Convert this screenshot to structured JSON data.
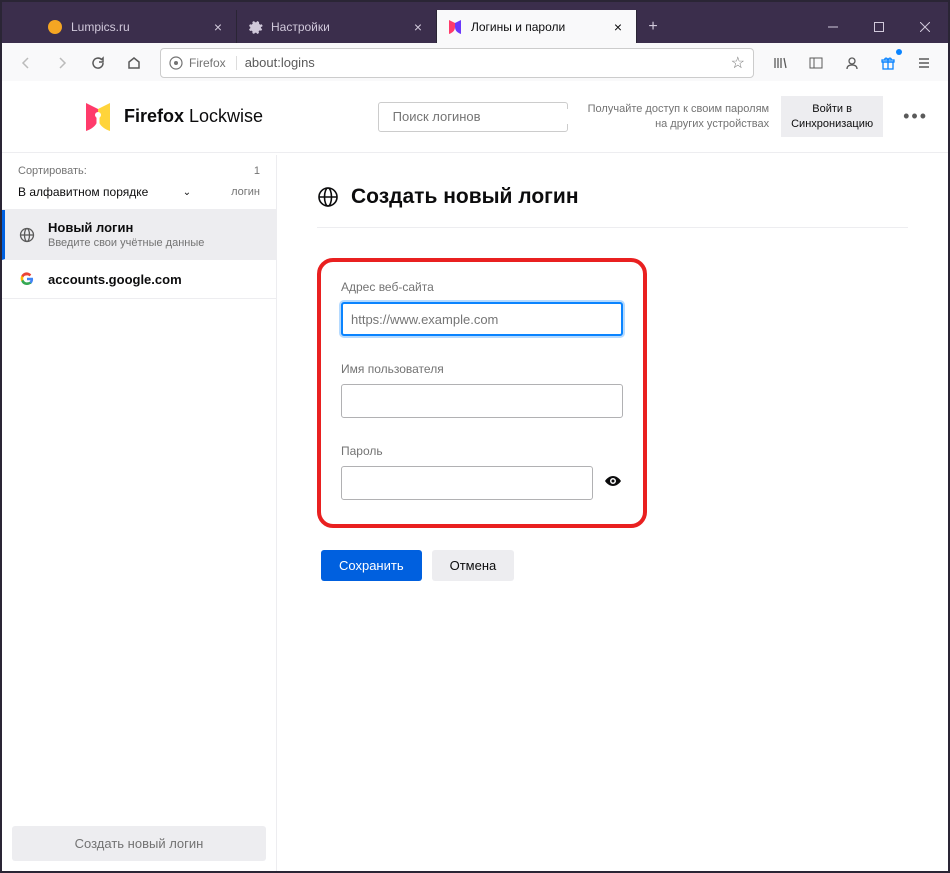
{
  "tabs": [
    {
      "label": "Lumpics.ru"
    },
    {
      "label": "Настройки"
    },
    {
      "label": "Логины и пароли"
    }
  ],
  "urlbar": {
    "identity": "Firefox",
    "url": "about:logins"
  },
  "header": {
    "brand_bold": "Firefox",
    "brand_light": "Lockwise",
    "search_placeholder": "Поиск логинов",
    "sync_text1": "Получайте доступ к своим паролям",
    "sync_text2": "на других устройствах",
    "sync_btn1": "Войти в",
    "sync_btn2": "Синхронизацию"
  },
  "sidebar": {
    "sort_label": "Сортировать:",
    "sort_value": "В алфавитном порядке",
    "count": "1",
    "count_label": "логин",
    "items": [
      {
        "title": "Новый логин",
        "sub": "Введите свои учётные данные"
      },
      {
        "title": "accounts.google.com",
        "sub": ""
      }
    ],
    "create_btn": "Создать новый логин"
  },
  "main": {
    "title": "Создать новый логин",
    "fields": {
      "website_label": "Адрес веб-сайта",
      "website_placeholder": "https://www.example.com",
      "username_label": "Имя пользователя",
      "password_label": "Пароль"
    },
    "save": "Сохранить",
    "cancel": "Отмена"
  }
}
